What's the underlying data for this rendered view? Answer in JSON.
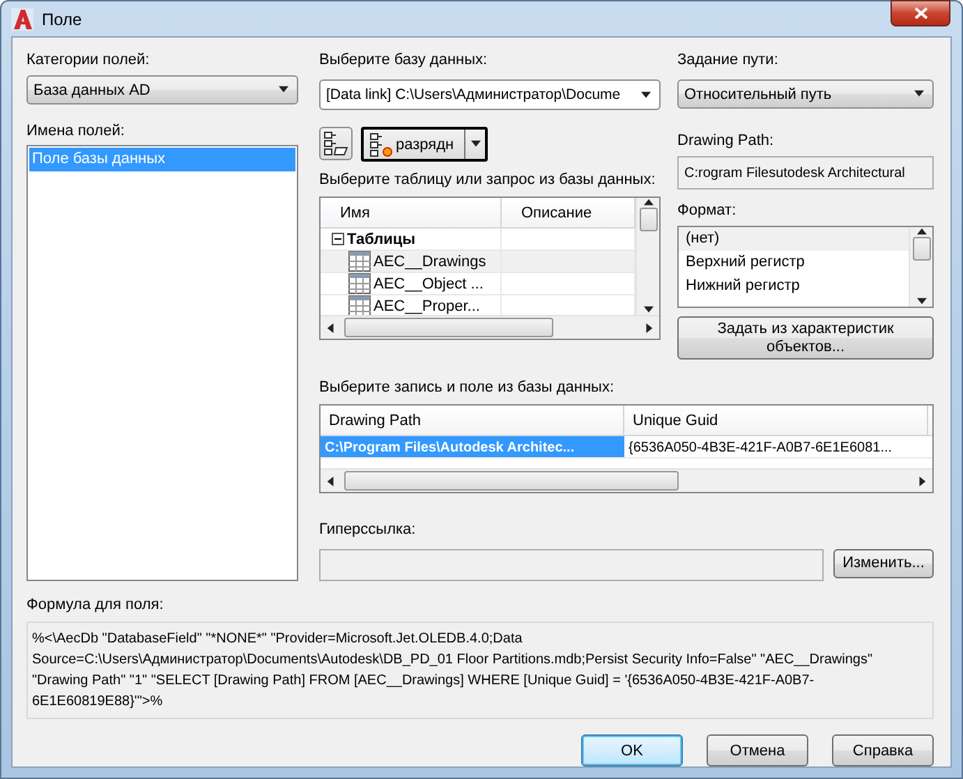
{
  "window": {
    "title": "Поле"
  },
  "categories": {
    "label": "Категории полей:",
    "value": "База данных AD"
  },
  "field_names": {
    "label": "Имена полей:",
    "items": [
      {
        "label": "Поле базы данных",
        "selected": true
      }
    ]
  },
  "database": {
    "label": "Выберите базу данных:",
    "value": "[Data link] C:\\Users\\Администратор\\Docume"
  },
  "toolbar": {
    "split_button": "разрядн"
  },
  "tables": {
    "label": "Выберите таблицу или запрос из базы данных:",
    "columns": [
      "Имя",
      "Описание"
    ],
    "tree": [
      {
        "label": "Таблицы",
        "expanded": true,
        "children": [
          {
            "label": "AEC__Drawings",
            "selected": true
          },
          {
            "label": "AEC__Object ...",
            "selected": false
          },
          {
            "label": "AEC__Proper...",
            "selected": false
          }
        ]
      }
    ]
  },
  "path_mode": {
    "label": "Задание пути:",
    "value": "Относительный путь"
  },
  "drawing_path": {
    "label": "Drawing Path:",
    "value": "C:rogram Filesutodesk Architectural"
  },
  "format": {
    "label": "Формат:",
    "items": [
      {
        "label": "(нет)",
        "selected": true
      },
      {
        "label": "Верхний регистр",
        "selected": false
      },
      {
        "label": "Нижний регистр",
        "selected": false
      }
    ]
  },
  "set_from_button": "Задать из характеристик объектов...",
  "records": {
    "label": "Выберите запись и поле из базы данных:",
    "columns": [
      "Drawing Path",
      "Unique Guid"
    ],
    "rows": [
      {
        "cells": [
          "C:\\Program Files\\Autodesk Architec...",
          "{6536A050-4B3E-421F-A0B7-6E1E6081..."
        ],
        "selected": true
      }
    ]
  },
  "hyperlink": {
    "label": "Гиперссылка:",
    "button": "Изменить..."
  },
  "formula": {
    "label": "Формула для поля:",
    "value": "%<\\AecDb \"DatabaseField\" \"*NONE*\" \"Provider=Microsoft.Jet.OLEDB.4.0;Data Source=C:\\Users\\Администратор\\Documents\\Autodesk\\DB_PD_01 Floor Partitions.mdb;Persist Security Info=False\" \"AEC__Drawings\" \"Drawing Path\" \"1\" \"SELECT [Drawing Path] FROM [AEC__Drawings] WHERE [Unique Guid] = '{6536A050-4B3E-421F-A0B7-6E1E60819E88}'\">%"
  },
  "buttons": [
    {
      "label": "OK",
      "default": true
    },
    {
      "label": "Отмена",
      "default": false
    },
    {
      "label": "Справка",
      "default": false
    }
  ]
}
